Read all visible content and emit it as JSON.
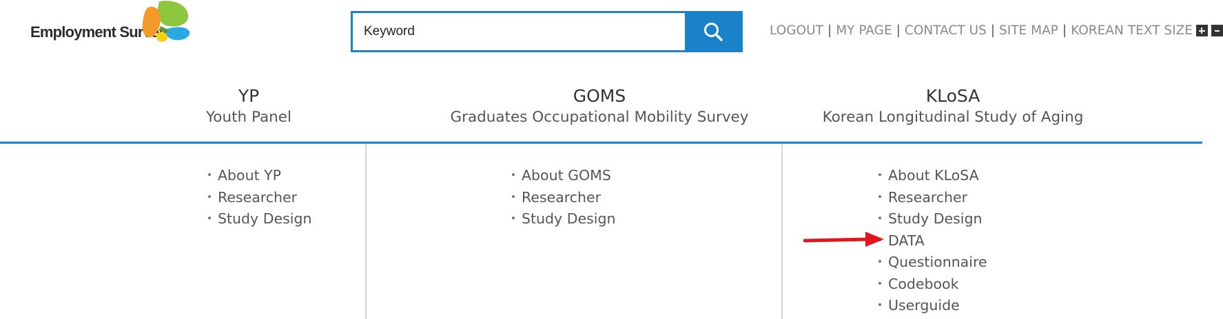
{
  "header": {
    "logo_text": "Employment Survey",
    "search": {
      "value": "Keyword"
    },
    "search_icon": "search-icon",
    "util_links": [
      "LOGOUT",
      "MY PAGE",
      "CONTACT US",
      "SITE MAP",
      "KOREAN"
    ],
    "text_size_label": "TEXT SIZE",
    "text_size_controls": [
      "plus-icon",
      "minus-icon"
    ]
  },
  "nav": [
    {
      "abbr": "YP",
      "full": "Youth Panel"
    },
    {
      "abbr": "GOMS",
      "full": "Graduates Occupational Mobility Survey"
    },
    {
      "abbr": "KLoSA",
      "full": "Korean Longitudinal Study of Aging"
    }
  ],
  "submenus": {
    "yp": [
      "About YP",
      "Researcher",
      "Study Design"
    ],
    "goms": [
      "About GOMS",
      "Researcher",
      "Study Design"
    ],
    "klosa": [
      "About KLoSA",
      "Researcher",
      "Study Design",
      "DATA",
      "Questionnaire",
      "Codebook",
      "Userguide"
    ]
  },
  "annotation": {
    "icon": "red-arrow-icon",
    "color": "#e3141b",
    "points_to": "DATA"
  },
  "colors": {
    "accent": "#1a82c8",
    "logo_orange": "#f39a2b",
    "logo_green": "#8cc63f",
    "logo_blue": "#29a9e1",
    "logo_yellow": "#f5d10f"
  }
}
